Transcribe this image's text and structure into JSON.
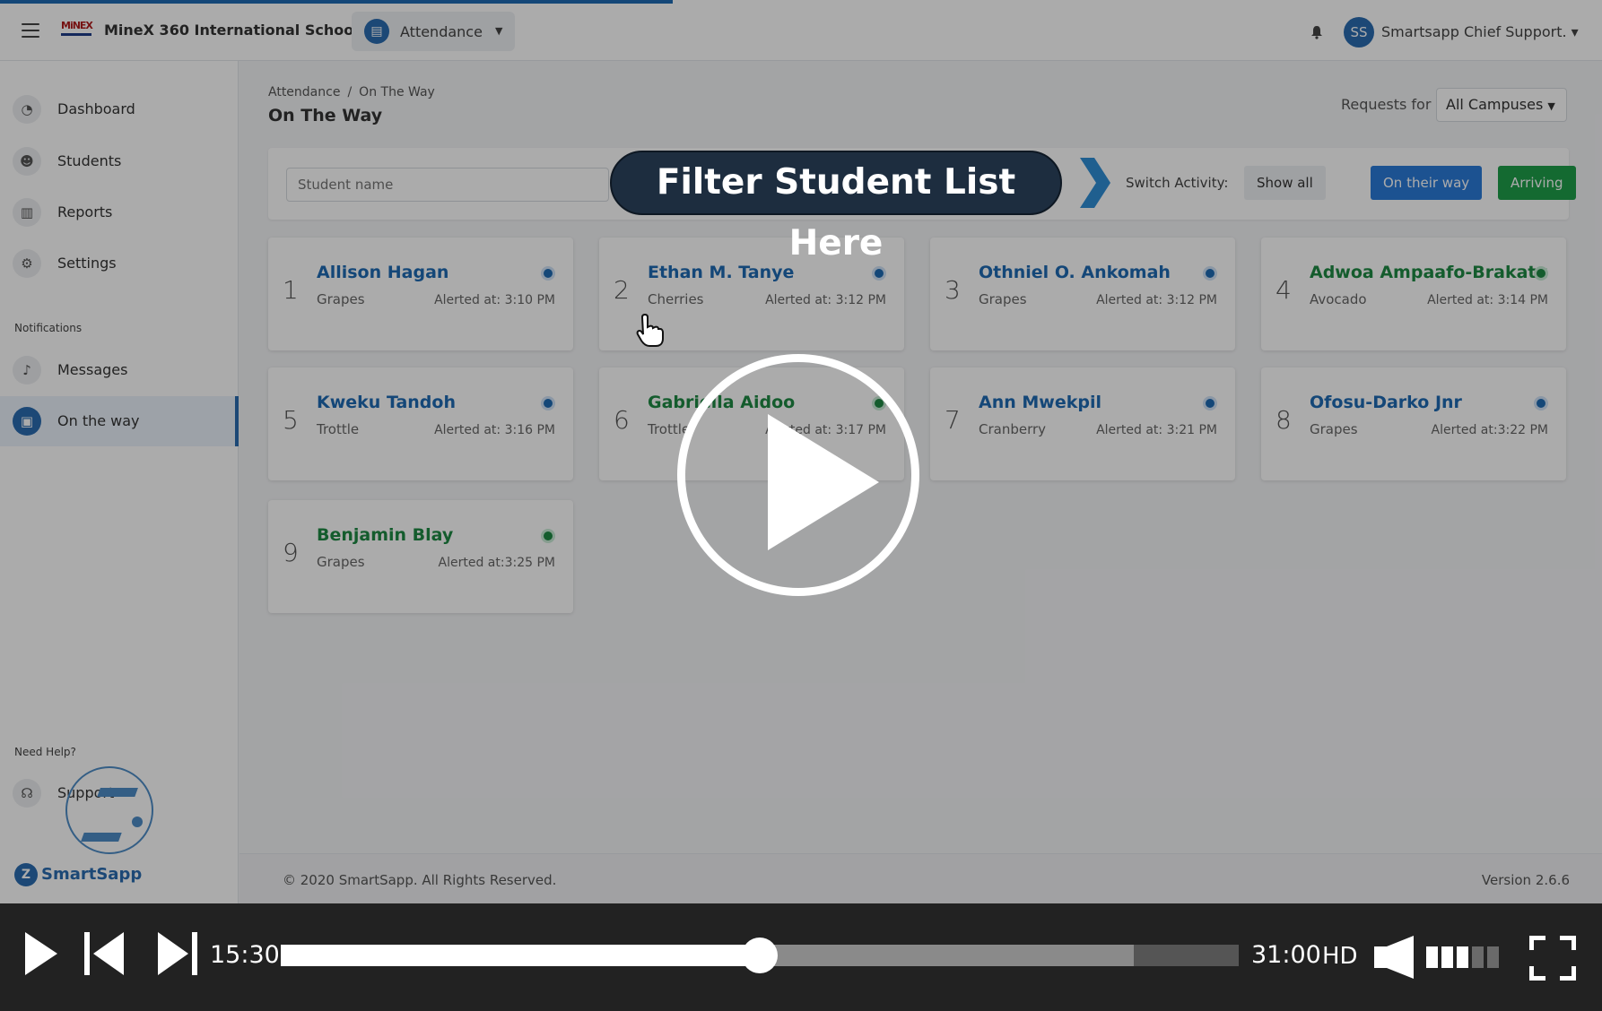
{
  "topbar": {
    "school_logo_text": "MiNEX",
    "school_name": "MineX 360 International School",
    "module": "Attendance",
    "user_initials": "SS",
    "user_name": "Smartsapp Chief Support. ▾"
  },
  "sidebar": {
    "items": [
      {
        "label": "Dashboard",
        "icon": "dashboard-icon"
      },
      {
        "label": "Students",
        "icon": "students-icon"
      },
      {
        "label": "Reports",
        "icon": "chart-icon"
      },
      {
        "label": "Settings",
        "icon": "gear-icon"
      }
    ],
    "notifications_label": "Notifications",
    "notification_items": [
      {
        "label": "Messages",
        "icon": "bell-icon"
      },
      {
        "label": "On the way",
        "icon": "bus-icon",
        "active": true
      }
    ],
    "help_label": "Need Help?",
    "support_label": "Support",
    "brand": "SmartSapp"
  },
  "main": {
    "breadcrumb": [
      "Attendance",
      "On The Way"
    ],
    "breadcrumb_sep": "/",
    "title": "On The Way",
    "requests_label": "Requests for",
    "campus": "All Campuses",
    "search_placeholder": "Student name",
    "switch_label": "Switch Activity:",
    "buttons": {
      "show_all": "Show all",
      "on_their_way": "On their way",
      "arriving": "Arriving"
    },
    "students": [
      {
        "num": "1",
        "name": "Allison Hagan",
        "group": "Grapes",
        "alerted": "Alerted at: 3:10 PM",
        "status": "blue"
      },
      {
        "num": "2",
        "name": "Ethan M. Tanye",
        "group": "Cherries",
        "alerted": "Alerted at: 3:12 PM",
        "status": "blue"
      },
      {
        "num": "3",
        "name": "Othniel O. Ankomah",
        "group": "Grapes",
        "alerted": "Alerted at: 3:12 PM",
        "status": "blue"
      },
      {
        "num": "4",
        "name": "Adwoa Ampaafo-Brakatu",
        "group": "Avocado",
        "alerted": "Alerted at: 3:14 PM",
        "status": "green"
      },
      {
        "num": "5",
        "name": "Kweku Tandoh",
        "group": "Trottle",
        "alerted": "Alerted at: 3:16 PM",
        "status": "blue"
      },
      {
        "num": "6",
        "name": "Gabriella Aidoo",
        "group": "Trottle",
        "alerted": "Alerted at: 3:17 PM",
        "status": "green"
      },
      {
        "num": "7",
        "name": "Ann Mwekpil",
        "group": "Cranberry",
        "alerted": "Alerted at: 3:21 PM",
        "status": "blue"
      },
      {
        "num": "8",
        "name": "Ofosu-Darko Jnr",
        "group": "Grapes",
        "alerted": "Alerted at:3:22 PM",
        "status": "blue"
      },
      {
        "num": "9",
        "name": "Benjamin Blay",
        "group": "Grapes",
        "alerted": "Alerted at:3:25 PM",
        "status": "green"
      }
    ],
    "footer_copyright": "© 2020 SmartSapp. All Rights Reserved.",
    "footer_version": "Version 2.6.6"
  },
  "annotation": {
    "callout": "Filter Student List Here"
  },
  "player": {
    "current_time": "15:30",
    "total_time": "31:00",
    "quality": "HD",
    "progress_fraction": 0.5,
    "buffered_fraction": 0.89,
    "volume_level": 3,
    "volume_max": 5
  },
  "colors": {
    "accent_blue": "#2b6cb0",
    "status_blue": "#1f6bb3",
    "status_green": "#1e8a44",
    "arriving_green": "#1e9e4a",
    "callout_bg": "#1d2d3f"
  }
}
